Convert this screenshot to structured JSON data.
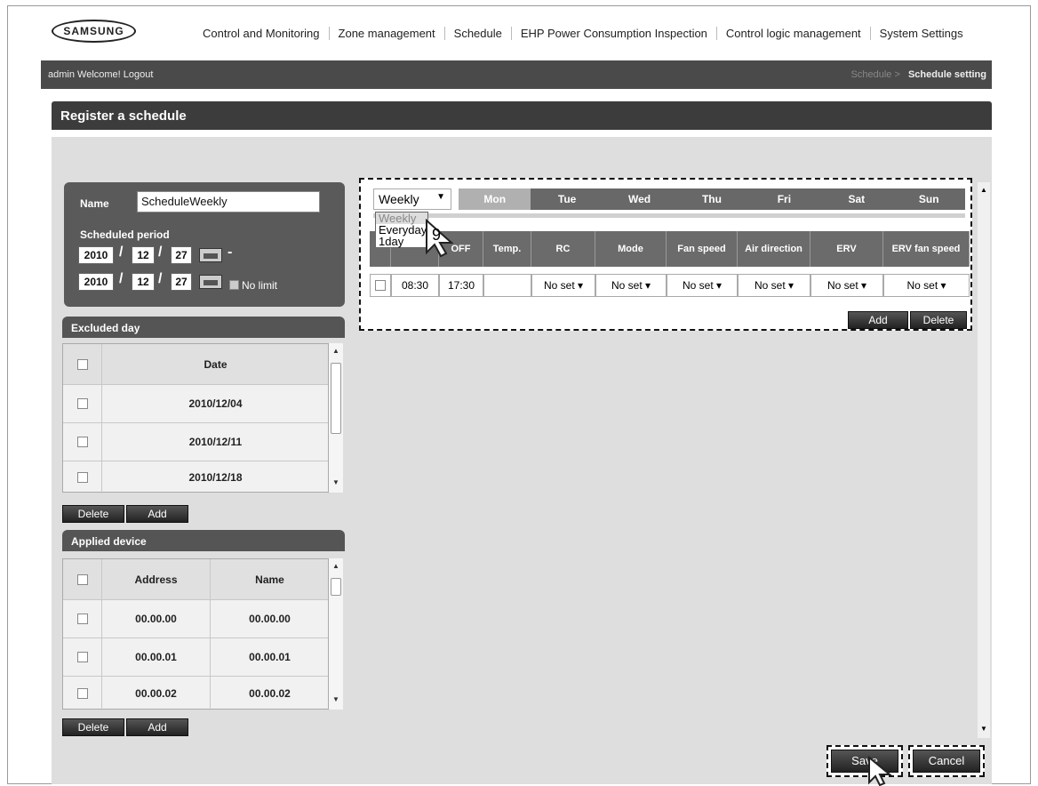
{
  "nav": {
    "logo": "SAMSUNG",
    "items": [
      "Control and Monitoring",
      "Zone management",
      "Schedule",
      "EHP Power Consumption Inspection",
      "Control logic management",
      "System Settings"
    ]
  },
  "bar": {
    "welcome": "admin Welcome! Logout",
    "crumb_parent": "Schedule >",
    "crumb_current": "Schedule setting"
  },
  "page_title": "Register a schedule",
  "form": {
    "name_label": "Name",
    "name_value": "ScheduleWeekly",
    "period_label": "Scheduled period",
    "start": {
      "year": "2010",
      "month": "12",
      "day": "27"
    },
    "end": {
      "year": "2010",
      "month": "12",
      "day": "27"
    },
    "no_limit": "No limit"
  },
  "excluded": {
    "title": "Excluded day",
    "header": "Date",
    "rows": [
      "2010/12/04",
      "2010/12/11",
      "2010/12/18"
    ],
    "delete": "Delete",
    "add": "Add"
  },
  "applied": {
    "title": "Applied device",
    "headers": [
      "Address",
      "Name"
    ],
    "rows": [
      [
        "00.00.00",
        "00.00.00"
      ],
      [
        "00.00.01",
        "00.00.01"
      ],
      [
        "00.00.02",
        "00.00.02"
      ]
    ],
    "delete": "Delete",
    "add": "Add"
  },
  "schedule": {
    "type_selected": "Weekly",
    "type_options": [
      "Weekly",
      "Everyday",
      "1day"
    ],
    "days": [
      "Mon",
      "Tue",
      "Wed",
      "Thu",
      "Fri",
      "Sat",
      "Sun"
    ],
    "columns": [
      "",
      "",
      "OFF",
      "Temp.",
      "RC",
      "Mode",
      "Fan speed",
      "Air direction",
      "ERV",
      "ERV fan speed"
    ],
    "row": {
      "on": "08:30",
      "off": "17:30",
      "temp": "",
      "rc": "No set",
      "mode": "No set",
      "fan": "No set",
      "air": "No set",
      "erv": "No set",
      "erv_fan": "No set"
    },
    "add": "Add",
    "delete": "Delete",
    "callout": "9"
  },
  "footer": {
    "save": "Save",
    "cancel": "Cancel"
  }
}
